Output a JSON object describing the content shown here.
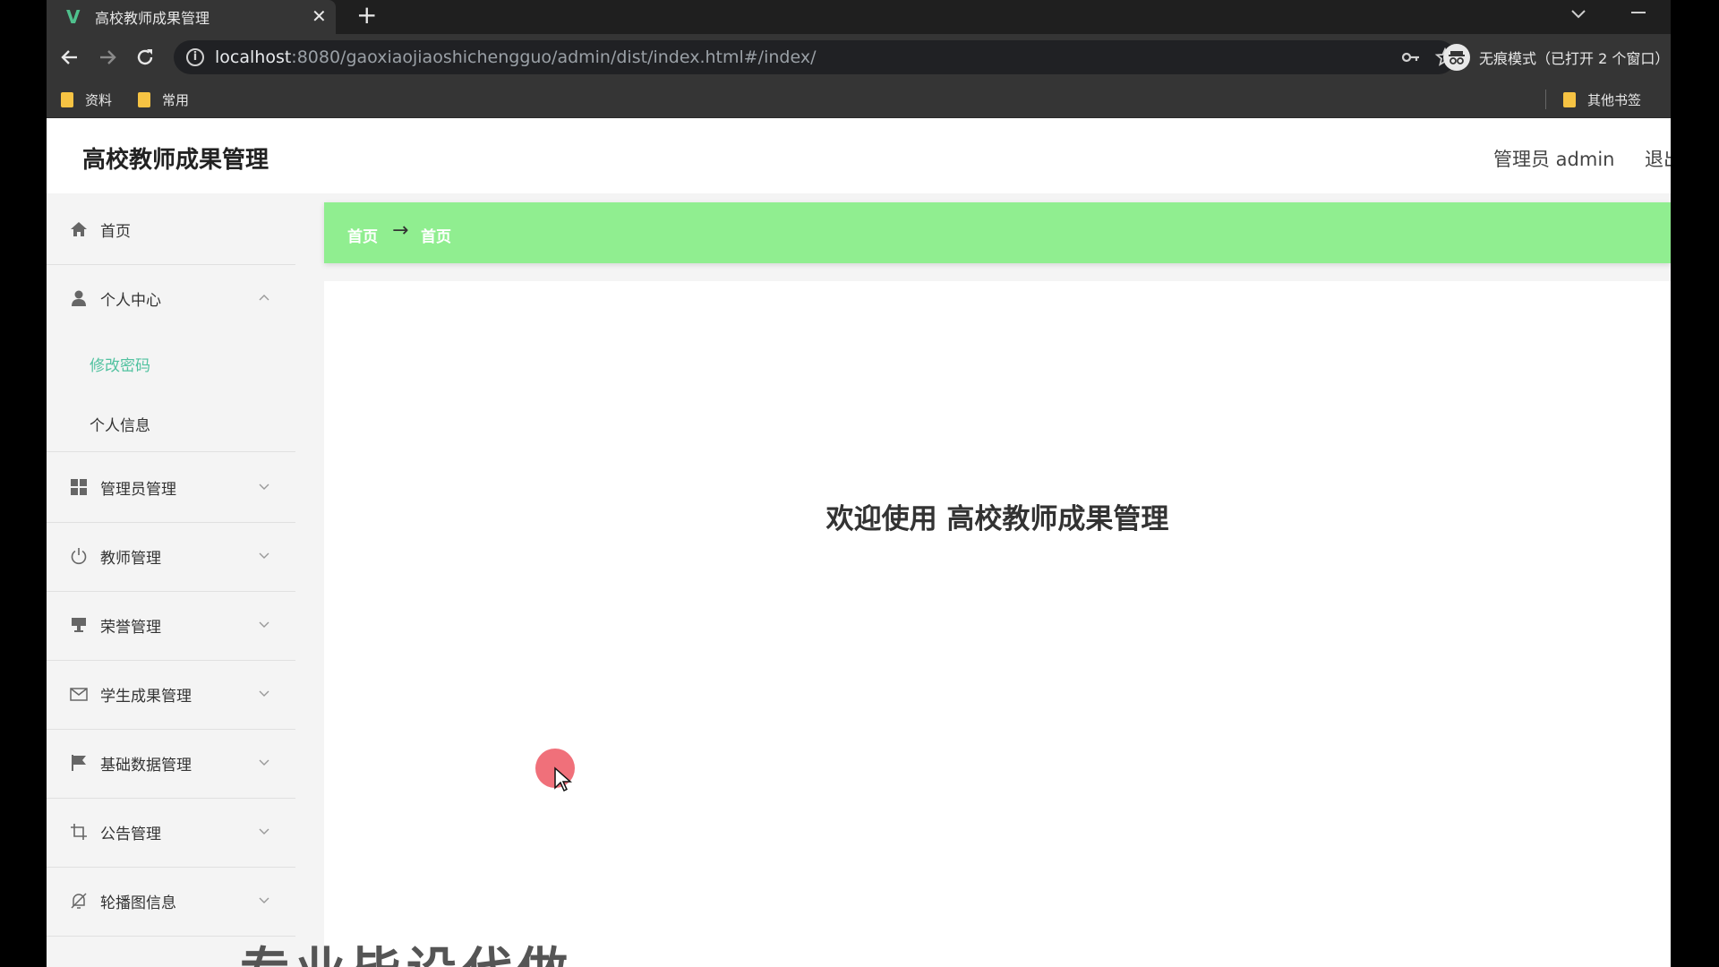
{
  "browser": {
    "tab_title": "高校教师成果管理",
    "url_host": "localhost",
    "url_rest": ":8080/gaoxiaojiaoshichengguo/admin/dist/index.html#/index/",
    "incognito_label": "无痕模式（已打开 2 个窗口）",
    "bookmarks": [
      {
        "label": "资料"
      },
      {
        "label": "常用"
      }
    ],
    "other_bookmarks": "其他书签"
  },
  "app": {
    "title": "高校教师成果管理",
    "user": "管理员 admin",
    "logout": "退出"
  },
  "sidebar": {
    "home": "首页",
    "personal_center": "个人中心",
    "change_password": "修改密码",
    "personal_info": "个人信息",
    "admin_mgmt": "管理员管理",
    "teacher_mgmt": "教师管理",
    "honor_mgmt": "荣誉管理",
    "student_achievement_mgmt": "学生成果管理",
    "basic_data_mgmt": "基础数据管理",
    "notice_mgmt": "公告管理",
    "carousel_info": "轮播图信息"
  },
  "breadcrumb": {
    "first": "首页",
    "separator": "→",
    "second": "首页"
  },
  "main": {
    "welcome": "欢迎使用 高校教师成果管理"
  },
  "overlay_caption": "专业毕设代做",
  "colors": {
    "accent": "#52c2a0",
    "breadcrumb_bg": "#90ee90",
    "favicon": "#4fc08d"
  }
}
